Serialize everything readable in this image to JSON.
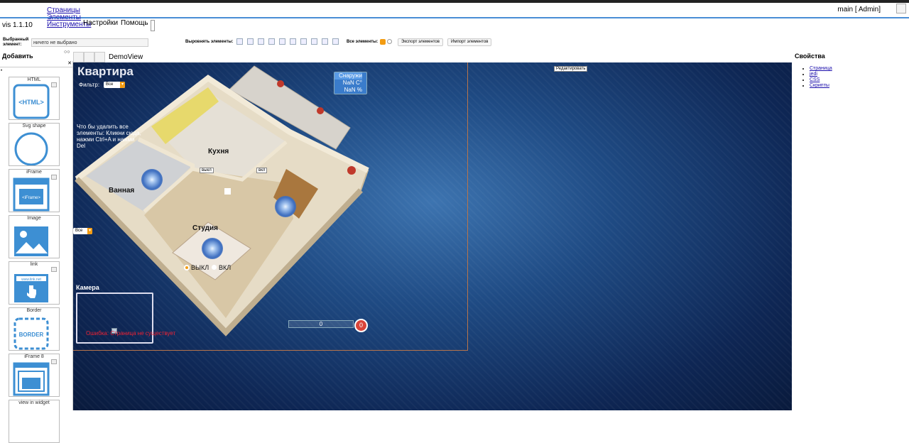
{
  "menu": {
    "pages": "Страницы",
    "elements": "Элементы",
    "tools": "Инструменты",
    "settings": "Настройки",
    "help": "Помощь"
  },
  "user": "main [ Admin]",
  "version": "vis 1.1.10",
  "toolbar": {
    "selected_label": "Выбранный элемент:",
    "selected_value": "ничего не выбрано",
    "align_label": "Выровнять элементы:",
    "all_label": "Все элементы:",
    "export_label": "Экспорт элементов",
    "import_label": "Импорт элементов"
  },
  "palette": {
    "title": "Добавить",
    "widgets": [
      "HTML",
      "Svg shape",
      "iFrame",
      "Image",
      "link",
      "Border",
      "iFrame 8",
      "view in widget"
    ]
  },
  "view": {
    "name": "DemoView",
    "edit_button": "Редактировать"
  },
  "canvas": {
    "title": "Квартира",
    "filter_label": "Фильтр:",
    "filter_value": "Все",
    "side_filter_value": "Все",
    "hint": "Что бы удалить все элементы: Кликни сюда, нажми Ctrl+A и нажми Del",
    "weather": [
      "Снаружи",
      "NaN C°",
      "NaN %"
    ],
    "rooms": {
      "kitchen": "Кухня",
      "bath": "Ванная",
      "studio": "Студия"
    },
    "mini_off": "выкл",
    "mini_on": "вкл",
    "radio_off": "ВЫКЛ",
    "radio_on": "ВКЛ",
    "camera_label": "Камера",
    "camera_error": "Ошибка: Страница не существует",
    "counter": "0",
    "badge": "0"
  },
  "properties": {
    "title": "Свойства",
    "links": [
      "Страница",
      "jedi",
      "CSS",
      "Скрипты"
    ]
  },
  "colors": {
    "accent": "#f39c12",
    "bar": "#4a8ed6",
    "error": "#e23333"
  }
}
